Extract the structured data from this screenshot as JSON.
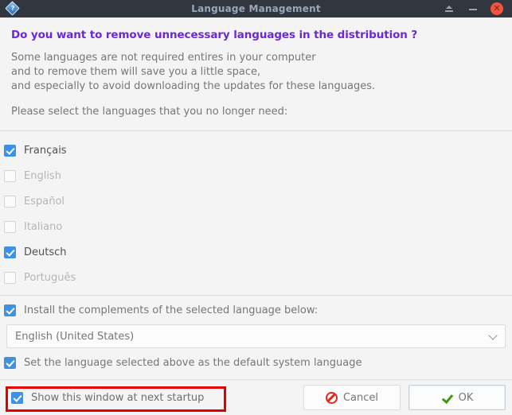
{
  "titlebar": {
    "title": "Language Management",
    "app_icon": "help-diamond-icon",
    "shade_label": "",
    "minimize_label": "",
    "close_label": "✕"
  },
  "intro": {
    "heading": "Do you want to remove unnecessary languages in the distribution ?",
    "line1": "Some languages are not required entires in your computer",
    "line2": "and to remove them will save you a little space,",
    "line3": "and especially to avoid downloading the updates for these languages.",
    "prompt": "Please select the languages that you no longer need:"
  },
  "languages": [
    {
      "label": "Français",
      "checked": true,
      "enabled": true
    },
    {
      "label": "English",
      "checked": false,
      "enabled": false
    },
    {
      "label": "Español",
      "checked": false,
      "enabled": false
    },
    {
      "label": "Italiano",
      "checked": false,
      "enabled": false
    },
    {
      "label": "Deutsch",
      "checked": true,
      "enabled": true
    },
    {
      "label": "Português",
      "checked": false,
      "enabled": false
    }
  ],
  "options": {
    "install_complements": {
      "label": "Install the complements of the selected language below:",
      "checked": true
    },
    "default_system_language": {
      "label": "Set the language selected above as the default system language",
      "checked": true
    }
  },
  "combo": {
    "value": "English (United States)",
    "chevron": "chevron-down-icon"
  },
  "footer": {
    "startup": {
      "label": "Show this window at next startup",
      "checked": true,
      "highlighted": true
    },
    "cancel_label": "Cancel",
    "ok_label": "OK"
  },
  "colors": {
    "titlebar_bg": "#31363f",
    "title_text": "#9aa7bb",
    "close_button": "#f1543f",
    "heading": "#6b29d6",
    "body_text": "#72777c",
    "checkbox_on": "#3d92e4",
    "disabled_text": "#b4b7ba",
    "highlight_border": "#e40000",
    "cancel_icon": "#e02a1e",
    "ok_icon": "#3a9a18",
    "window_bg": "#f4f4f4"
  }
}
